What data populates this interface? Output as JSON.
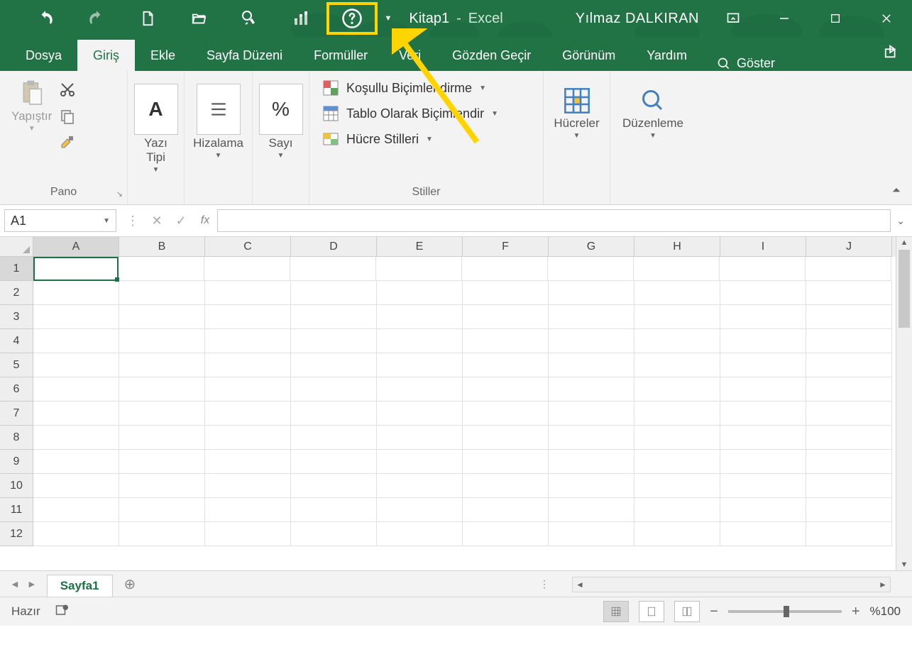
{
  "title": {
    "document": "Kitap1",
    "separator": "-",
    "app": "Excel"
  },
  "user": "Yılmaz DALKIRAN",
  "tabs": {
    "dosya": "Dosya",
    "giris": "Giriş",
    "ekle": "Ekle",
    "sayfa": "Sayfa Düzeni",
    "formul": "Formüller",
    "veri": "Veri",
    "gozden": "Gözden Geçir",
    "gorunum": "Görünüm",
    "yardim": "Yardım",
    "tellme": "Göster"
  },
  "ribbon": {
    "pano": {
      "label": "Pano",
      "paste": "Yapıştır"
    },
    "yazi": {
      "label": "Yazı Tipi"
    },
    "hizalama": {
      "label": "Hizalama"
    },
    "sayi": {
      "label": "Sayı"
    },
    "stiller": {
      "label": "Stiller",
      "kosullu": "Koşullu Biçimlendirme",
      "tablo": "Tablo Olarak Biçimlendir",
      "hucre": "Hücre Stilleri"
    },
    "hucreler": {
      "label": "Hücreler"
    },
    "duzenleme": {
      "label": "Düzenleme"
    }
  },
  "namebox": "A1",
  "columns": [
    "A",
    "B",
    "C",
    "D",
    "E",
    "F",
    "G",
    "H",
    "I",
    "J"
  ],
  "rows": [
    "1",
    "2",
    "3",
    "4",
    "5",
    "6",
    "7",
    "8",
    "9",
    "10",
    "11",
    "12"
  ],
  "sheet": {
    "tab": "Sayfa1"
  },
  "status": {
    "ready": "Hazır",
    "zoom": "%100"
  }
}
